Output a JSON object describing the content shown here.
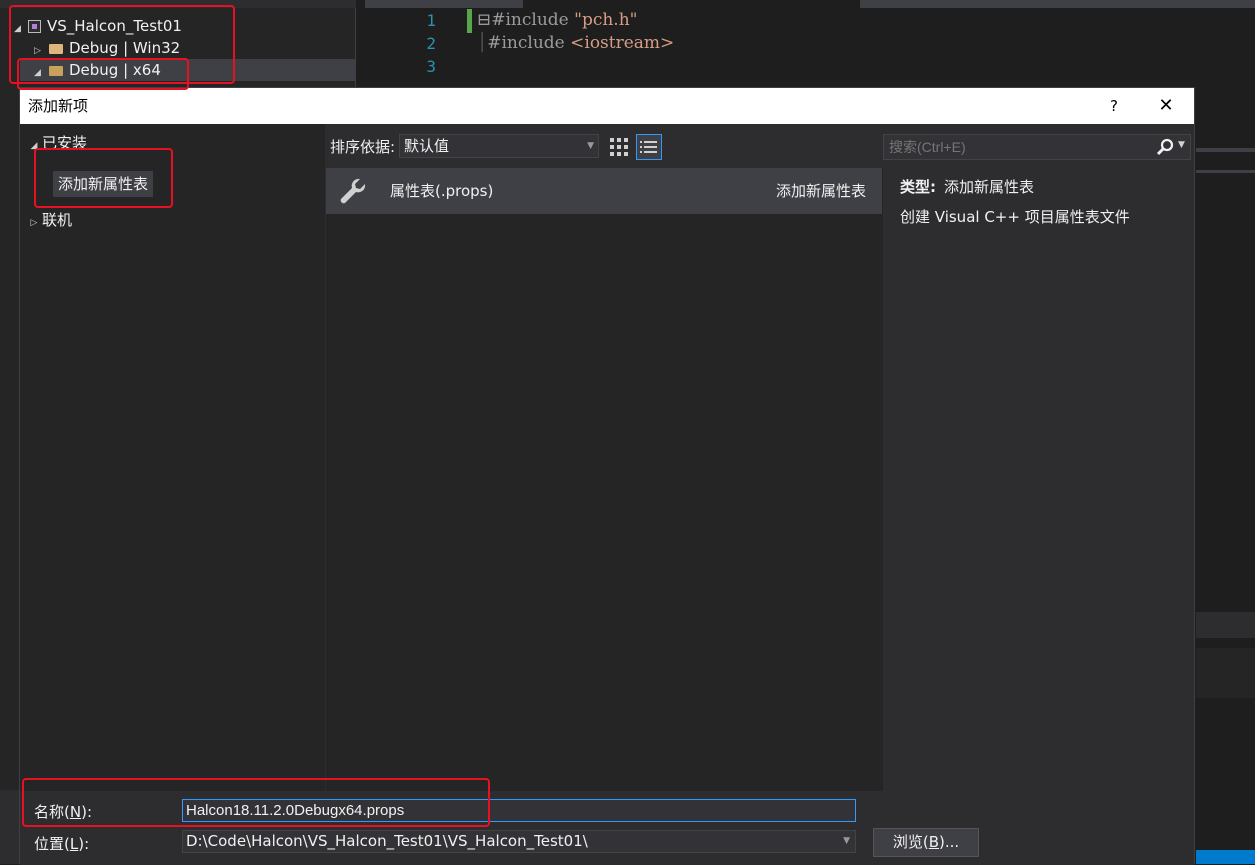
{
  "solution_explorer": {
    "project_name": "VS_Halcon_Test01",
    "configs": [
      {
        "label": "Debug | Win32",
        "expanded": false
      },
      {
        "label": "Debug | x64",
        "expanded": true
      }
    ]
  },
  "editor": {
    "lines": [
      {
        "num": "1",
        "prefix": "#include ",
        "string": "\"pch.h\""
      },
      {
        "num": "2",
        "prefix": "#include ",
        "string": "<iostream>"
      },
      {
        "num": "3",
        "prefix": "",
        "string": ""
      }
    ]
  },
  "dialog": {
    "title": "添加新项",
    "help_label": "?",
    "close_label": "✕",
    "left_tree": {
      "installed_label": "已安装",
      "selected_template": "添加新属性表",
      "online_label": "联机"
    },
    "toolbar": {
      "sort_label": "排序依据:",
      "sort_value": "默认值"
    },
    "search": {
      "placeholder": "搜索(Ctrl+E)"
    },
    "items": [
      {
        "name": "属性表(.props)",
        "category": "添加新属性表",
        "icon": "wrench-icon"
      }
    ],
    "info": {
      "type_label": "类型:",
      "type_value": "添加新属性表",
      "description": "创建 Visual C++ 项目属性表文件"
    },
    "name_field": {
      "label": "名称(",
      "accelerator": "N",
      "label_end": "):",
      "value": "Halcon18.11.2.0Debugx64.props"
    },
    "location_field": {
      "label": "位置(",
      "accelerator": "L",
      "label_end": "):",
      "value": "D:\\Code\\Halcon\\VS_Halcon_Test01\\VS_Halcon_Test01\\"
    },
    "browse_button": {
      "label": "浏览(",
      "accelerator": "B",
      "label_end": ")..."
    }
  },
  "colors": {
    "accent": "#3399ff",
    "annotation": "#e81123",
    "background": "#2d2d30"
  }
}
